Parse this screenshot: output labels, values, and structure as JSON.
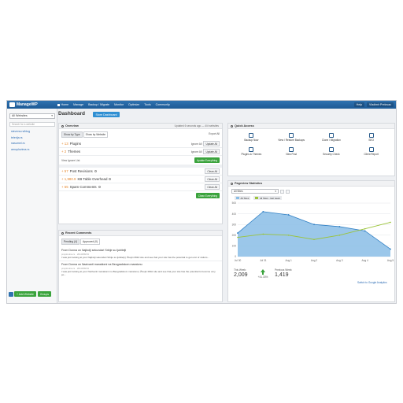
{
  "nav": {
    "logo": "ManageWP",
    "items": [
      "Home",
      "Manage",
      "Backup / Migrate",
      "Monitor",
      "Optimize",
      "Tools",
      "Community"
    ],
    "help": "Help",
    "user": "Vladimir Prelovac"
  },
  "sidebar": {
    "select": "All Websites",
    "search_placeholder": "Search for a website",
    "sites": [
      "stevens.rs/blog",
      "telerija.rs",
      "nasumel.rs",
      "amuplovima.rs"
    ],
    "add_website": "+ Add Website",
    "groups": "Groups"
  },
  "header": {
    "title": "Dashboard",
    "store_button": "Store Dashboard"
  },
  "overview": {
    "title": "Overview",
    "updated": "Updated 6 seconds ago — 4/4 websites",
    "tabs": [
      "Show by Type",
      "Show by Website"
    ],
    "export": "Export All",
    "updates": [
      {
        "count": "+ 13",
        "label": "Plugins"
      },
      {
        "count": "+ 2",
        "label": "Themes"
      }
    ],
    "ignore_all": "Ignore All",
    "update_all": "Update All",
    "view_ignore_list": "View Ignore List",
    "update_everything": "Update Everything",
    "cleanup": [
      {
        "count": "+ 57",
        "label": "Post Revisions"
      },
      {
        "count": "+ 1,980.9",
        "label": "KB Table Overhead"
      },
      {
        "count": "+ 55",
        "label": "Spam Comments"
      }
    ],
    "clean_all": "Clean All",
    "clean_everything": "Clean Everything"
  },
  "recent_comments": {
    "title": "Recent Comments",
    "tabs": [
      "Pending (4)",
      "Approved (0)"
    ],
    "comments": [
      {
        "title": "From Donna on Najbolji sekundari Srbije su ljubitelji",
        "meta": "proplovina.rs · 2013/08/19",
        "body": "I was just looking at your Najbolji sekundari Srbije su ljubitelji | Živojin Mišić site and see that your site has the potential to get a lot of visitors..."
      },
      {
        "title": "From Donna on Nazivanti manatiomi na Beogradskom maratonu",
        "meta": "proplovina.rs · 2013/08/19",
        "body": "I was just looking at your Nazivanti manatiomi na Beogradskom maratonu | Živojin Mišić site and see that your site has the potential to become very po..."
      }
    ]
  },
  "quick_access": {
    "title": "Quick Access",
    "items": [
      {
        "label": "Backup Now",
        "icon": "backup-icon"
      },
      {
        "label": "View / Restore Backups",
        "icon": "restore-icon"
      },
      {
        "label": "Clone / Migration",
        "icon": "clone-icon"
      },
      {
        "label": "SEO",
        "icon": "seo-icon"
      },
      {
        "label": "Plugins & Themes",
        "icon": "plugins-icon"
      },
      {
        "label": "New Post",
        "icon": "new-post-icon"
      },
      {
        "label": "Security Check",
        "icon": "security-icon"
      },
      {
        "label": "Client Report",
        "icon": "report-icon"
      }
    ]
  },
  "pageview": {
    "title": "Pageview Statistics",
    "select": "All Sites",
    "legend": [
      "All Sites",
      "All Sites - last week"
    ],
    "stats": {
      "this_week_label": "This Week:",
      "this_week": "2,009",
      "change": "+41.33%",
      "previous_week_label": "Previous Week:",
      "previous_week": "1,419"
    },
    "ga_link": "Switch to Google Analytics"
  },
  "chart_data": {
    "type": "area",
    "categories": [
      "Jul 30",
      "Jul 31",
      "Aug 1",
      "Aug 2",
      "Aug 3",
      "Aug 4",
      "Aug 5"
    ],
    "series": [
      {
        "name": "All Sites",
        "values": [
          220,
          420,
          390,
          300,
          280,
          240,
          70
        ],
        "color": "#89bde6"
      },
      {
        "name": "All Sites - last week",
        "values": [
          180,
          210,
          200,
          160,
          200,
          260,
          320
        ],
        "color": "#9bc43a"
      }
    ],
    "yticks": [
      0,
      100,
      200,
      300,
      400,
      500
    ],
    "ylim": [
      0,
      500
    ],
    "grid": true
  },
  "colors": {
    "nav": "#1d5a95",
    "accent_blue": "#2f8fd3",
    "green": "#3aa33c",
    "orange": "#e6862a"
  }
}
